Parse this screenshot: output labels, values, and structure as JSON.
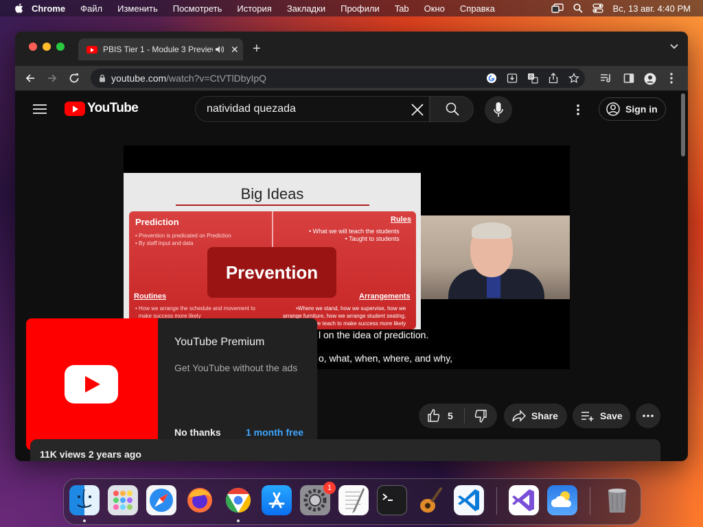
{
  "menubar": {
    "items": [
      {
        "label": "Chrome",
        "bold": true
      },
      {
        "label": "Файл"
      },
      {
        "label": "Изменить"
      },
      {
        "label": "Посмотреть"
      },
      {
        "label": "История"
      },
      {
        "label": "Закладки"
      },
      {
        "label": "Профили"
      },
      {
        "label": "Tab"
      },
      {
        "label": "Окно"
      },
      {
        "label": "Справка"
      }
    ],
    "clock": "Вс, 13 авг.  4:40 PM"
  },
  "browser": {
    "tab_title": "PBIS Tier 1 - Module 3 Preview",
    "url_host": "youtube.com",
    "url_path": "/watch?v=CtVTlDbyIpQ"
  },
  "youtube": {
    "logo_text": "YouTube",
    "search_value": "natividad quezada",
    "signin_label": "Sign in",
    "video": {
      "slide_title": "Big Ideas",
      "prediction": "Prediction",
      "prediction_bullets": "• Prevention is predicated on Prediction\n• By staff input and data",
      "rules": "Rules",
      "rules_bullets": "• What we will teach the students\n• Taught to students",
      "prevention": "Prevention",
      "routines": "Routines",
      "routines_bullets": "• How we arrange the schedule and movement to\n  make success more likely",
      "arrangements": "Arrangements",
      "arrangements_bullets": "•Where we stand, how we supervise, how we\narrange furniture, how we arrange student seating,\nhow we teach to make success more likely",
      "caption_1": "l on the idea of prediction.",
      "caption_2": "o, what, when, where, and why,"
    },
    "promo": {
      "title": "YouTube Premium",
      "subtitle": "Get YouTube without the ads",
      "dismiss": "No thanks",
      "cta": "1 month free"
    },
    "actions": {
      "likes": "5",
      "share": "Share",
      "save": "Save"
    },
    "description": {
      "meta": "11K views  2 years ago"
    }
  },
  "dock": {
    "apps": [
      "finder-icon",
      "launchpad-icon",
      "safari-icon",
      "firefox-icon",
      "chrome-icon",
      "app-store-icon",
      "system-settings-icon",
      "textedit-icon",
      "terminal-icon",
      "garageband-icon",
      "vscode-icon",
      "visual-studio-icon",
      "weather-icon",
      "trash-icon"
    ],
    "settings_badge": "1"
  },
  "colors": {
    "youtube_red": "#ff0000",
    "link_blue": "#3ea6ff",
    "yt_bg": "#0f0f0f"
  }
}
